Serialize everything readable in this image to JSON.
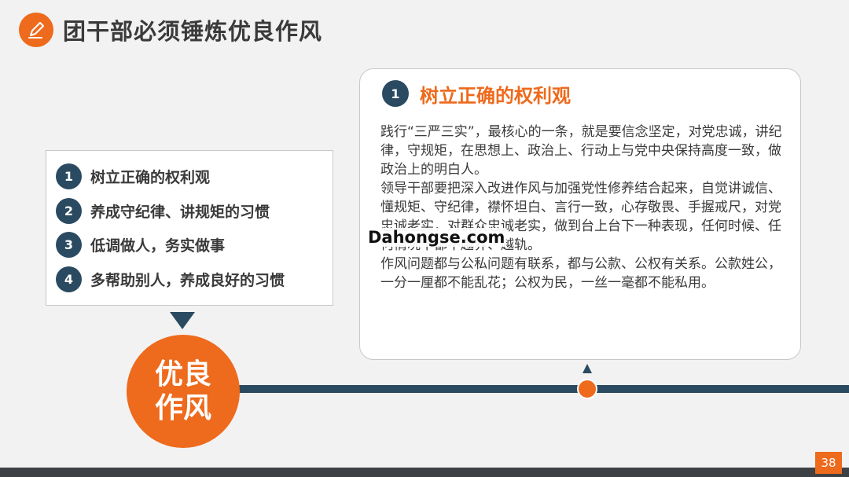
{
  "header": {
    "icon": "pencil-icon",
    "title": "团干部必须锤炼优良作风"
  },
  "left_panel": {
    "items": [
      {
        "number": "1",
        "label": "树立正确的权利观"
      },
      {
        "number": "2",
        "label": "养成守纪律、讲规矩的习惯"
      },
      {
        "number": "3",
        "label": "低调做人，务实做事"
      },
      {
        "number": "4",
        "label": "多帮助别人，养成良好的习惯"
      }
    ]
  },
  "center_circle": {
    "line1": "优良",
    "line2": "作风"
  },
  "detail_card": {
    "number": "1",
    "title": "树立正确的权利观",
    "paragraphs": [
      "践行“三严三实”，最核心的一条，就是要信念坚定，对党忠诚，讲纪律，守规矩，在思想上、政治上、行动上与党中央保持高度一致，做政治上的明白人。",
      "领导干部要把深入改进作风与加强党性修养结合起来，自觉讲诚信、懂规矩、守纪律，襟怀坦白、言行一致，心存敬畏、手握戒尺，对党忠诚老实，对群众忠诚老实，做到台上台下一种表现，任何时候、任何情况下都不越界、越轨。",
      "作风问题都与公私问题有联系，都与公款、公权有关系。公款姓公，一分一厘都不能乱花；公权为民，一丝一毫都不能私用。"
    ]
  },
  "watermark": "Dahongse.com",
  "page_number": "38",
  "colors": {
    "accent": "#ee6a1c",
    "navy": "#2a4a61",
    "background": "#f2f2f2"
  }
}
